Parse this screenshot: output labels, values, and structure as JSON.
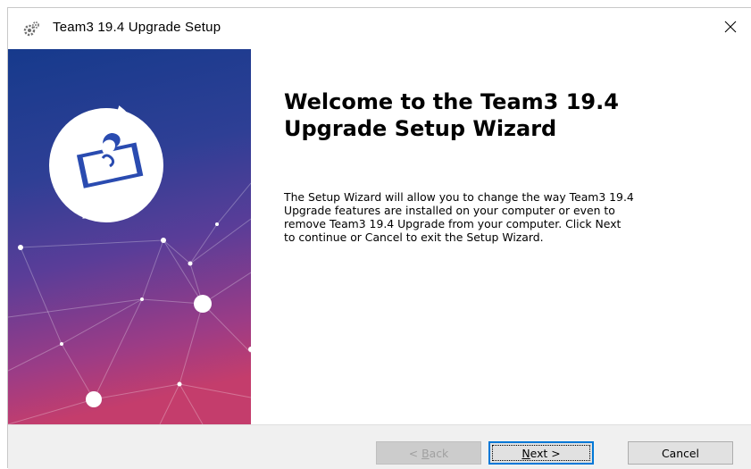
{
  "window": {
    "title": "Team3 19.4 Upgrade Setup",
    "icons": {
      "app": "setup-gear-icon",
      "close": "close-icon"
    }
  },
  "banner": {
    "logo": "puzzle-logo-icon",
    "colors": {
      "top": "#1e3a8a",
      "middle": "#4e3a96",
      "bottom": "#c23a6a"
    }
  },
  "content": {
    "heading_line1": "Welcome to the Team3 19.4",
    "heading_line2": "Upgrade Setup Wizard",
    "description_lines": [
      "The Setup Wizard will allow you to change the way Team3 19.4",
      "Upgrade features are installed on your computer or even to",
      "remove Team3 19.4 Upgrade from your computer.  Click Next",
      "to continue or Cancel to exit the Setup Wizard."
    ]
  },
  "buttons": {
    "back_prefix": "< ",
    "back_mnemonic": "B",
    "back_rest": "ack",
    "back_enabled": false,
    "next_mnemonic": "N",
    "next_rest": "ext >",
    "cancel": "Cancel"
  },
  "colors": {
    "focus_border": "#0078d7",
    "footer_bg": "#f0f0f0"
  }
}
